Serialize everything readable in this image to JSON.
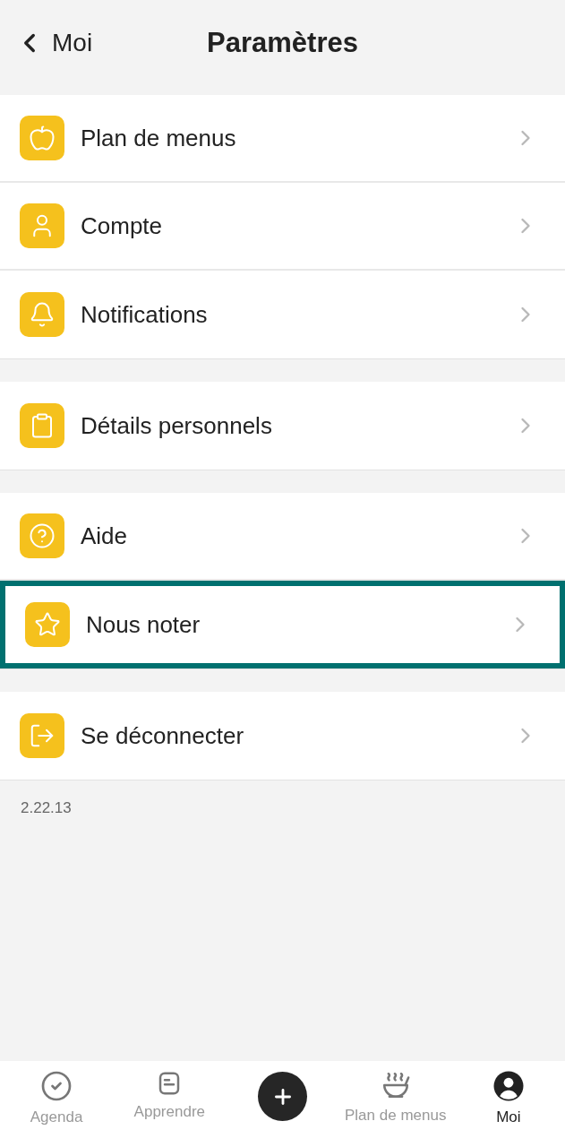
{
  "header": {
    "back": "Moi",
    "title": "Paramètres"
  },
  "groups": [
    {
      "items": [
        {
          "label": "Plan de menus",
          "highlighted": false
        },
        {
          "label": "Compte",
          "highlighted": false
        },
        {
          "label": "Notifications",
          "highlighted": false
        }
      ]
    },
    {
      "items": [
        {
          "label": "Détails personnels",
          "highlighted": false
        }
      ]
    },
    {
      "items": [
        {
          "label": "Aide",
          "highlighted": false
        },
        {
          "label": "Nous noter",
          "highlighted": true
        }
      ]
    },
    {
      "items": [
        {
          "label": "Se déconnecter",
          "highlighted": false
        }
      ]
    }
  ],
  "version": "2.22.13",
  "tab_bar": [
    {
      "kind": "tab",
      "label": "Agenda",
      "selected": false
    },
    {
      "kind": "tab",
      "label": "Apprendre",
      "selected": false
    },
    {
      "kind": "add"
    },
    {
      "kind": "tab",
      "label": "Plan de menus",
      "selected": false
    },
    {
      "kind": "tab",
      "label": "Moi",
      "selected": true
    }
  ]
}
